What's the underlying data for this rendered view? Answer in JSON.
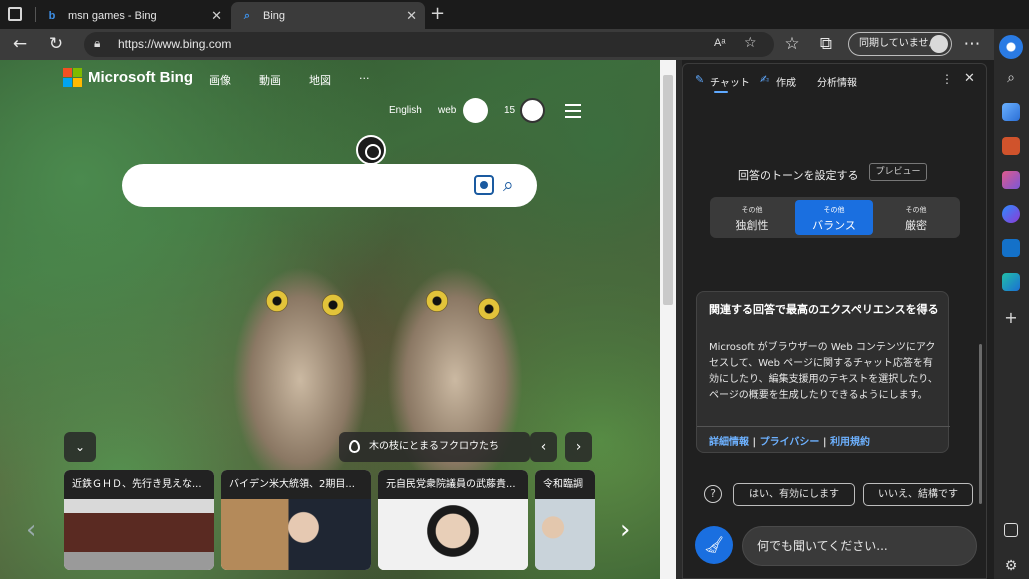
{
  "tabs": [
    {
      "label": "msn games - Bing",
      "active": false
    },
    {
      "label": "Bing",
      "active": true
    }
  ],
  "address": {
    "url": "https://www.bing.com",
    "read_aloud_icon": "Aᵃ"
  },
  "toolbar": {
    "sync_label": "同期していません"
  },
  "bing": {
    "logo_text": "Microsoft Bing",
    "nav": [
      "画像",
      "動画",
      "地図",
      "···"
    ],
    "lang": "English",
    "web": "web",
    "points": "15",
    "caption": "木の枝にとまるフクロウたち",
    "news": [
      {
        "title": "近鉄ＧＨＤ、先行き見えな..."
      },
      {
        "title": "バイデン米大統領、2期目..."
      },
      {
        "title": "元自民党衆院議員の武藤貴..."
      },
      {
        "title": "令和臨調"
      }
    ]
  },
  "copilot": {
    "tabs": [
      "チャット",
      "作成",
      "分析情報"
    ],
    "tone_title": "回答のトーンを設定する",
    "preview": "プレビュー",
    "tones": [
      {
        "small": "その他",
        "label": "独創性",
        "selected": false
      },
      {
        "small": "その他",
        "label": "バランス",
        "selected": true
      },
      {
        "small": "その他",
        "label": "厳密",
        "selected": false
      }
    ],
    "card_title": "関連する回答で最高のエクスペリエンスを得る",
    "card_body": "Microsoft がブラウザーの Web コンテンツにアクセスして、Web ページに関するチャット応答を有効にしたり、編集支援用のテキストを選択したり、ページの概要を生成したりできるようにします。",
    "links": [
      "詳細情報",
      "プライバシー",
      "利用規約"
    ],
    "link_sep": "|",
    "accept": "はい、有効にします",
    "decline": "いいえ、結構です",
    "input_placeholder": "何でも聞いてください..."
  },
  "colors": {
    "accent": "#1a6fe0",
    "link": "#6db1ff"
  }
}
